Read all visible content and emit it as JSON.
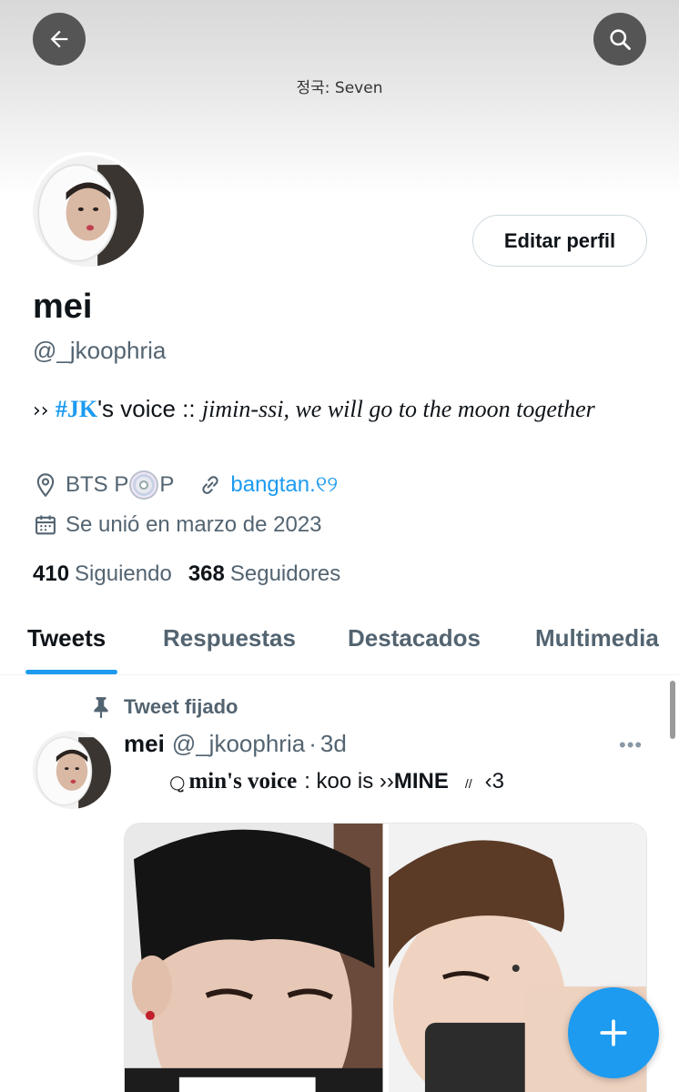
{
  "banner": {
    "caption": "정국: Seven"
  },
  "header": {
    "back_icon": "arrow-left-icon",
    "search_icon": "search-icon"
  },
  "profile": {
    "edit_label": "Editar perfil",
    "name": "mei",
    "handle": "@_jkoophria",
    "bio": {
      "prefix": "››",
      "hashtag": "#JK",
      "after_tag": "'s voice ::",
      "italic": "jimin-ssi, we will go to the moon together"
    },
    "location_a": "BTS P",
    "location_b": "P",
    "link": "bangtan.୧୨",
    "joined": "Se unió en marzo de 2023",
    "following_count": "410",
    "following_label": "Siguiendo",
    "followers_count": "368",
    "followers_label": "Seguidores"
  },
  "tabs": [
    "Tweets",
    "Respuestas",
    "Destacados",
    "Multimedia"
  ],
  "active_tab": "Tweets",
  "tweet": {
    "pinned_label": "Tweet fijado",
    "name": "mei",
    "handle": "@_jkoophria",
    "dot": "·",
    "time": "3d",
    "more": "•••",
    "text_symbol": "○̤̮ ",
    "text_bold": "min's voice",
    "text_mid": ": koo is ››",
    "text_mine": "MINE",
    "text_slashes": "//",
    "text_end": "‹3"
  },
  "colors": {
    "accent": "#1d9bf0",
    "secondary_text": "#536471",
    "primary_text": "#0f1419"
  }
}
